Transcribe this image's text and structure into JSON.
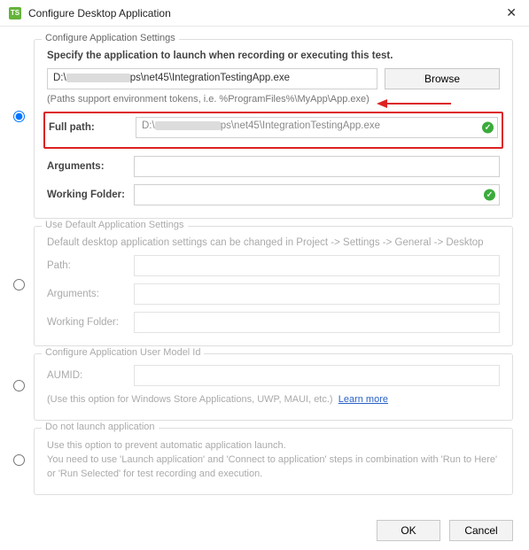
{
  "title": "Configure Desktop Application",
  "section1": {
    "legend": "Configure Application Settings",
    "instruction": "Specify the application to launch when recording or executing this test.",
    "path_prefix": "D:\\",
    "path_suffix": "ps\\net45\\IntegrationTestingApp.exe",
    "browse": "Browse",
    "hint": "(Paths support environment tokens, i.e. %ProgramFiles%\\MyApp\\App.exe)",
    "full_path_label": "Full path:",
    "full_path_prefix": "D:\\",
    "full_path_suffix": "ps\\net45\\IntegrationTestingApp.exe",
    "arguments_label": "Arguments:",
    "working_folder_label": "Working Folder:"
  },
  "section2": {
    "legend": "Use Default Application Settings",
    "instruction": "Default desktop application settings can be changed in Project -> Settings -> General -> Desktop",
    "path_label": "Path:",
    "arguments_label": "Arguments:",
    "working_folder_label": "Working Folder:"
  },
  "section3": {
    "legend": "Configure Application User Model Id",
    "aumid_label": "AUMID:",
    "hint": "(Use this option for Windows Store Applications, UWP, MAUI, etc.)",
    "learn_more": "Learn more"
  },
  "section4": {
    "legend": "Do not launch application",
    "line1": "Use this option to prevent automatic application launch.",
    "line2": "You need to use 'Launch application' and 'Connect to application' steps in combination with 'Run to Here' or 'Run Selected' for test recording and execution."
  },
  "footer": {
    "ok": "OK",
    "cancel": "Cancel"
  }
}
